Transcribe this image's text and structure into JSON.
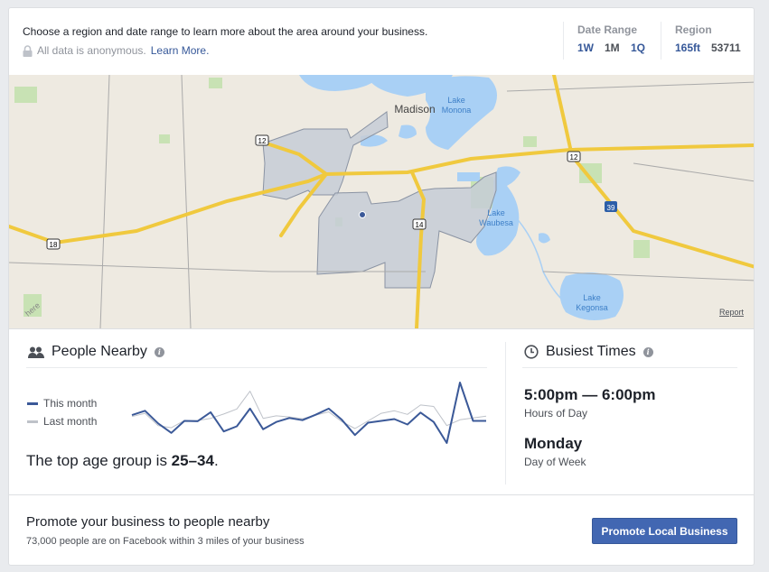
{
  "header": {
    "intro": "Choose a region and date range to learn more about the area around your business.",
    "anonymous": "All data is anonymous.",
    "learn_more": "Learn More.",
    "date_range": {
      "label": "Date Range",
      "options": [
        "1W",
        "1M",
        "1Q"
      ]
    },
    "region": {
      "label": "Region",
      "options": [
        "165ft",
        "53711"
      ]
    }
  },
  "map": {
    "labels": {
      "city": "Madison",
      "lake_monona": [
        "Lake",
        "Monona"
      ],
      "lake_waubesa": [
        "Lake",
        "Waubesa"
      ],
      "lake_kegonsa": [
        "Lake",
        "Kegonsa"
      ]
    },
    "shields": [
      "12",
      "12",
      "18",
      "14",
      "39"
    ],
    "report": "Report",
    "watermark": "here"
  },
  "people_nearby": {
    "title": "People Nearby",
    "legend": [
      "This month",
      "Last month"
    ],
    "top_age_prefix": "The top age group is ",
    "top_age": "25–34",
    "top_age_suffix": "."
  },
  "busiest_times": {
    "title": "Busiest Times",
    "hours": "5:00pm — 6:00pm",
    "hours_label": "Hours of Day",
    "day": "Monday",
    "day_label": "Day of Week"
  },
  "chart_data": {
    "type": "line",
    "series": [
      {
        "name": "This month",
        "color": "#3b5998",
        "values": [
          93,
          105,
          70,
          44,
          77,
          76,
          101,
          48,
          62,
          111,
          54,
          74,
          85,
          79,
          94,
          111,
          80,
          38,
          72,
          77,
          82,
          67,
          100,
          74,
          16,
          183,
          77,
          77
        ]
      },
      {
        "name": "Last month",
        "color": "#bec2c9",
        "values": [
          89,
          98,
          64,
          58,
          78,
          78,
          84,
          96,
          110,
          159,
          84,
          91,
          88,
          83,
          93,
          102,
          75,
          56,
          77,
          98,
          105,
          95,
          121,
          117,
          64,
          80,
          85,
          90
        ]
      }
    ],
    "grid": false,
    "legend": "left"
  },
  "footer": {
    "title": "Promote your business to people nearby",
    "subtitle": "73,000 people are on Facebook within 3 miles of your business",
    "button": "Promote Local Business"
  },
  "colors": {
    "accent": "#365899",
    "button": "#4267b2",
    "water": "#a9d0f5",
    "road": "#f5d35b",
    "region": "#c5ccd6"
  }
}
